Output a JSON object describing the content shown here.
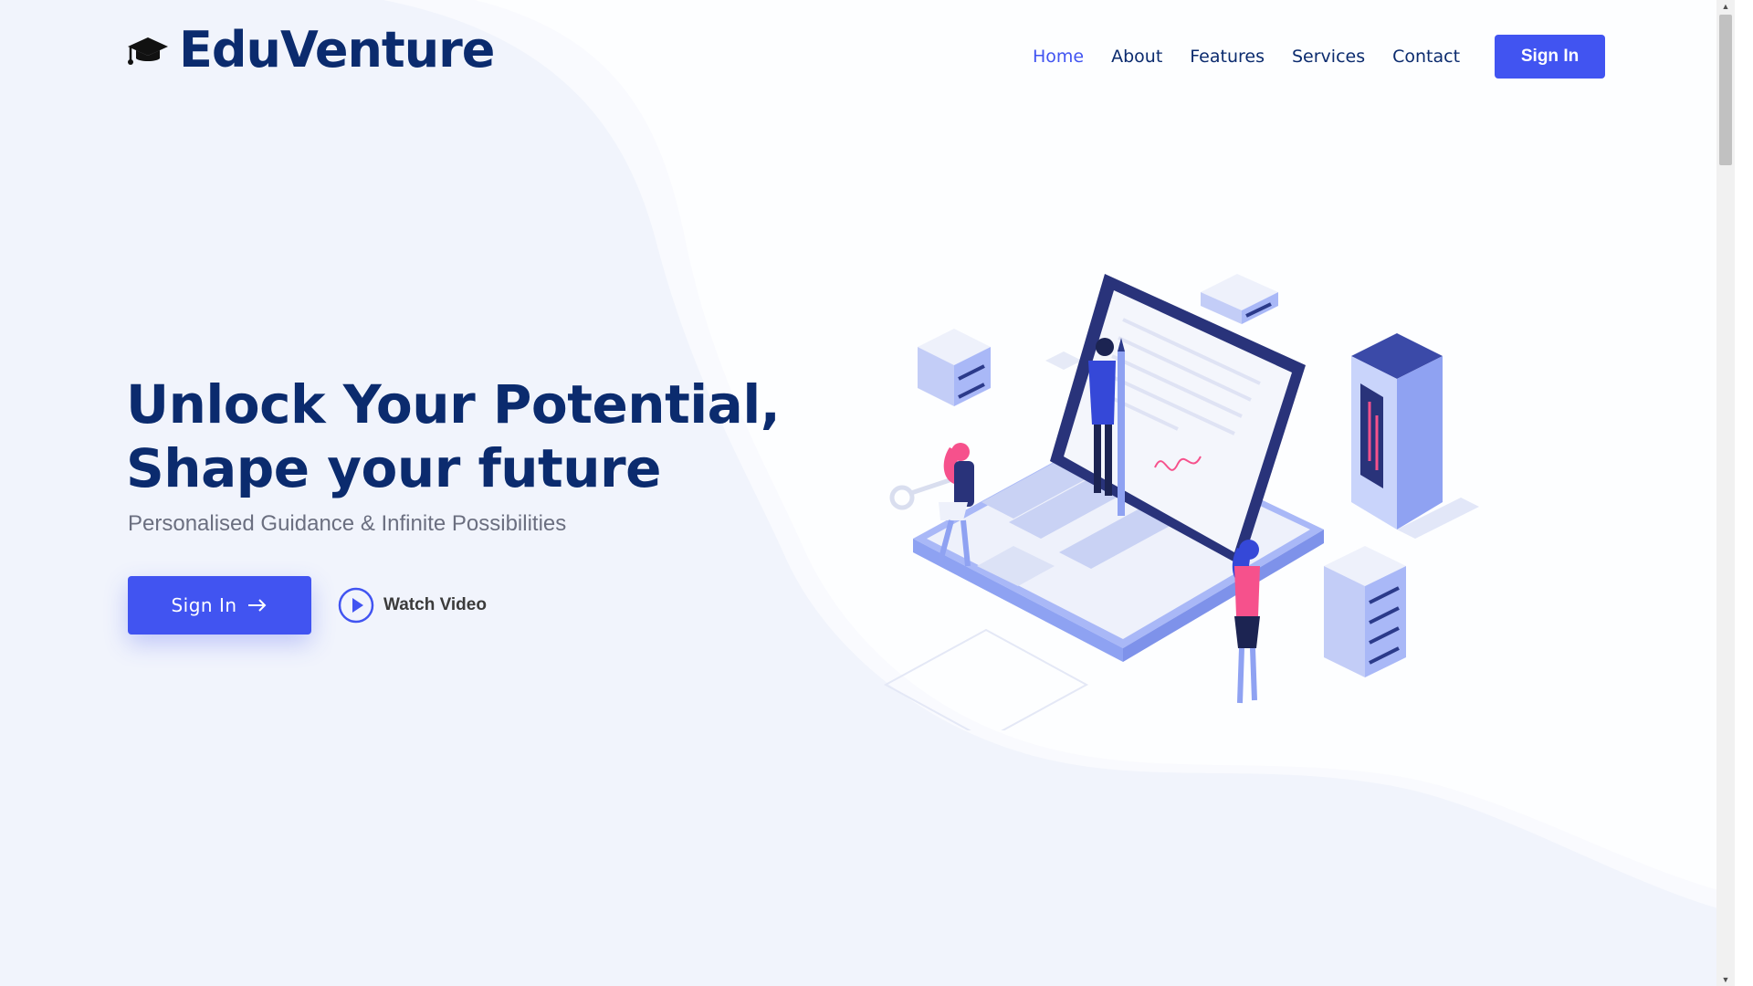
{
  "brand": {
    "name": "EduVenture",
    "icon": "graduation-cap-icon"
  },
  "nav": {
    "items": [
      {
        "label": "Home",
        "active": true
      },
      {
        "label": "About",
        "active": false
      },
      {
        "label": "Features",
        "active": false
      },
      {
        "label": "Services",
        "active": false
      },
      {
        "label": "Contact",
        "active": false
      }
    ],
    "signin_label": "Sign In"
  },
  "hero": {
    "title_line1": "Unlock Your Potential,",
    "title_line2": "Shape your future",
    "subtitle": "Personalised Guidance & Infinite Possibilities",
    "signin_label": "Sign In",
    "signin_icon": "arrow-right-icon",
    "watch_video_label": "Watch Video",
    "watch_video_icon": "play-circle-icon",
    "illustration": "isometric-laptop-illustration"
  },
  "colors": {
    "accent": "#4154f1",
    "heading": "#0b2b6e",
    "muted": "#6b6f80",
    "background": "#f1f4fc",
    "pink": "#f6518c"
  }
}
